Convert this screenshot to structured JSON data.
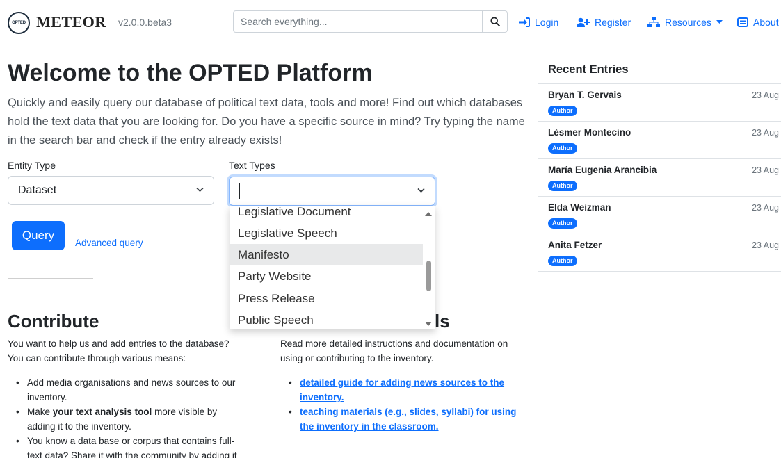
{
  "header": {
    "logo_text": "OPTED",
    "brand": "METEOR",
    "version": "v2.0.0.beta3",
    "search_placeholder": "Search everything...",
    "search_icon": "search-icon",
    "nav": {
      "login": "Login",
      "register": "Register",
      "resources": "Resources",
      "about": "About"
    }
  },
  "hero": {
    "title": "Welcome to the OPTED Platform",
    "text": "Quickly and easily query our database of political text data, tools and more! Find out which databases hold the text data that you are looking for. Do you have a specific source in mind? Try typing the name in the search bar and check if the entry already exists!"
  },
  "form": {
    "entity_label": "Entity Type",
    "entity_value": "Dataset",
    "text_types_label": "Text Types",
    "text_types_value": "",
    "query_button": "Query",
    "advanced_link": "Advanced query"
  },
  "dropdown": {
    "items": [
      "Legislative Document",
      "Legislative Speech",
      "Manifesto",
      "Party Website",
      "Press Release",
      "Public Speech"
    ],
    "highlighted": "Manifesto"
  },
  "contribute": {
    "title": "Contribute",
    "intro": "You want to help us and add entries to the database? You can contribute through various means:",
    "bullet1": "Add media organisations and news sources to our inventory.",
    "bullet2_pre": "Make ",
    "bullet2_bold": "your text analysis tool",
    "bullet2_post": " more visible by adding it to the inventory.",
    "bullet3": "You know a data base or corpus that contains full-text data? Share it with the community by adding it"
  },
  "tutorials": {
    "title_visible": "ls",
    "intro": "Read more detailed instructions and documentation on using or contributing to the inventory.",
    "link1": "detailed guide for adding news sources to the inventory.",
    "link2": "teaching materials (e.g., slides, syllabi) for using the inventory in the classroom."
  },
  "recent": {
    "title": "Recent Entries",
    "entries": [
      {
        "name": "Bryan T. Gervais",
        "badge": "Author",
        "date": "23 Aug"
      },
      {
        "name": "Lésmer Montecino",
        "badge": "Author",
        "date": "23 Aug"
      },
      {
        "name": "María Eugenia Arancibia",
        "badge": "Author",
        "date": "23 Aug"
      },
      {
        "name": "Elda Weizman",
        "badge": "Author",
        "date": "23 Aug"
      },
      {
        "name": "Anita Fetzer",
        "badge": "Author",
        "date": "23 Aug"
      }
    ]
  },
  "colors": {
    "primary": "#0d6efd",
    "text": "#212529",
    "muted": "#6c757d"
  }
}
